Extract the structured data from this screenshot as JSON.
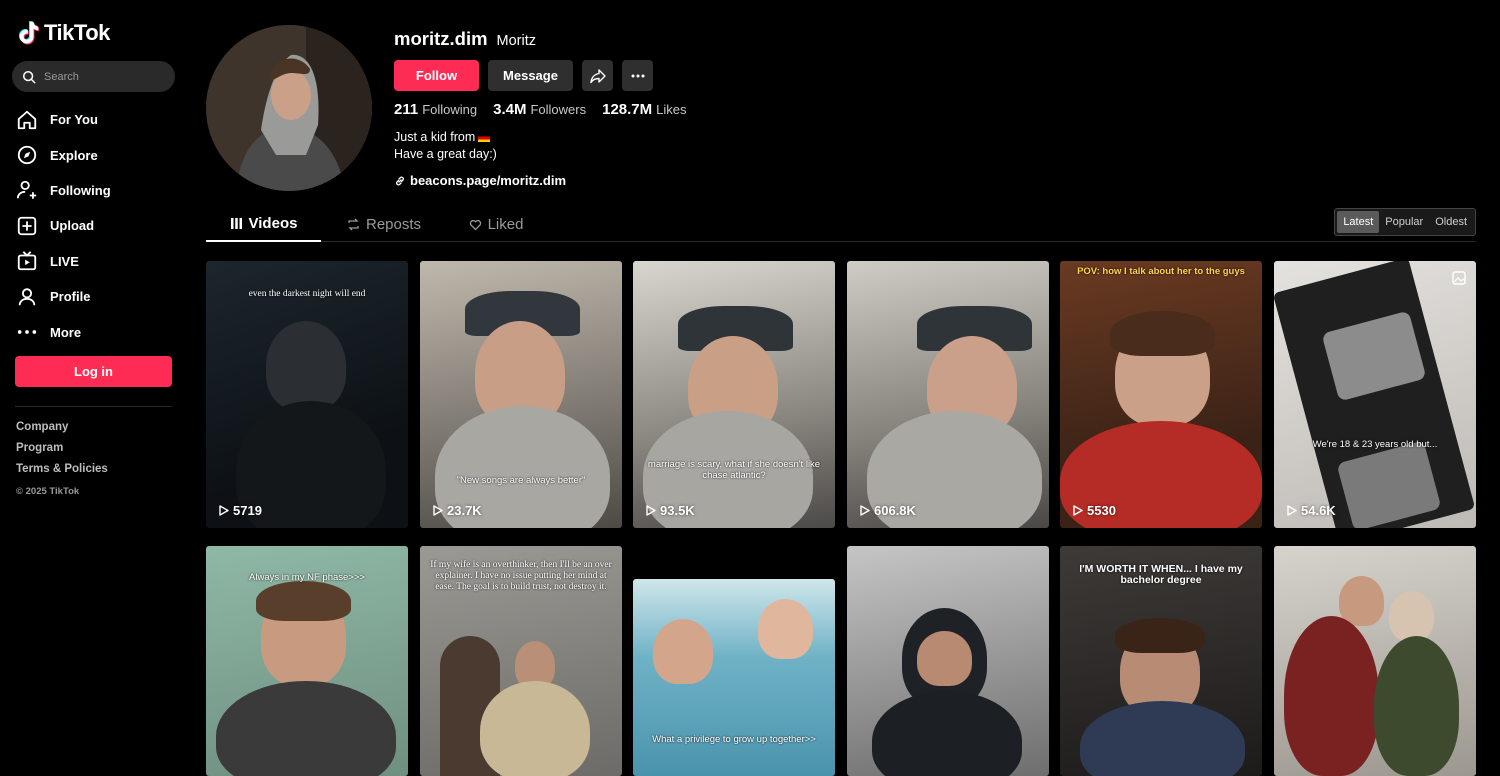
{
  "brand": {
    "name": "TikTok",
    "accent": "#fe2c55"
  },
  "search": {
    "placeholder": "Search"
  },
  "nav": [
    {
      "label": "For You",
      "icon": "home-icon"
    },
    {
      "label": "Explore",
      "icon": "compass-icon"
    },
    {
      "label": "Following",
      "icon": "following-icon"
    },
    {
      "label": "Upload",
      "icon": "upload-icon"
    },
    {
      "label": "LIVE",
      "icon": "live-icon"
    },
    {
      "label": "Profile",
      "icon": "profile-icon"
    },
    {
      "label": "More",
      "icon": "more-icon"
    }
  ],
  "login_label": "Log in",
  "footer": {
    "links": [
      "Company",
      "Program",
      "Terms & Policies"
    ],
    "copyright": "© 2025 TikTok"
  },
  "profile": {
    "username": "moritz.dim",
    "nickname": "Moritz",
    "follow_label": "Follow",
    "message_label": "Message",
    "stats": {
      "following": {
        "value": "211",
        "label": "Following"
      },
      "followers": {
        "value": "3.4M",
        "label": "Followers"
      },
      "likes": {
        "value": "128.7M",
        "label": "Likes"
      }
    },
    "bio_line1": "Just a kid from",
    "bio_line2": "Have a great day:)",
    "link": "beacons.page/moritz.dim"
  },
  "tabs": {
    "videos": "Videos",
    "reposts": "Reposts",
    "liked": "Liked"
  },
  "sort": {
    "latest": "Latest",
    "popular": "Popular",
    "oldest": "Oldest"
  },
  "videos": [
    {
      "caption": "even the darkest night will end",
      "views": "5719"
    },
    {
      "caption": "\"New songs are always better\"",
      "views": "23.7K"
    },
    {
      "caption": "marriage is scary, what if she doesn't like chase atlantic?",
      "views": "93.5K"
    },
    {
      "caption": "",
      "views": "606.8K"
    },
    {
      "caption": "POV: how I talk about her to the guys",
      "views": "5530"
    },
    {
      "caption": "We're 18 & 23 years old but...",
      "views": "54.6K"
    },
    {
      "caption": "Always in my NF phase>>>",
      "views": ""
    },
    {
      "caption": "If my wife is an overthinker, then I'll be an over explainer. I have no issue putting her mind at ease. The goal is to build trust, not destroy it.",
      "views": ""
    },
    {
      "caption": "What a privilege to grow up together>>",
      "views": ""
    },
    {
      "caption": "",
      "views": ""
    },
    {
      "caption": "I'M WORTH IT WHEN... I have my bachelor degree",
      "views": ""
    },
    {
      "caption": "",
      "views": ""
    }
  ]
}
